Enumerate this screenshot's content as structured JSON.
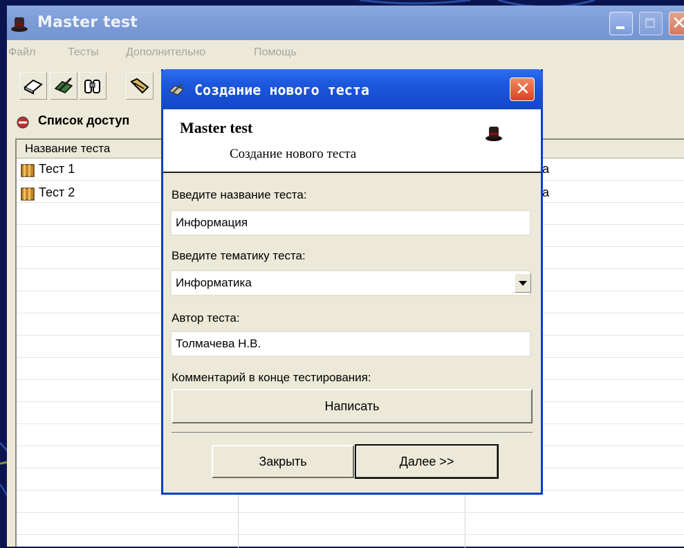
{
  "main_window": {
    "title": "Master test",
    "menu": [
      "Файл",
      "Тесты",
      "Дополнительно",
      "Помощь"
    ],
    "list_heading": "Список доступ",
    "list_columns": [
      "Название теста"
    ],
    "tests": [
      {
        "name": "Тест 1",
        "tail": "а"
      },
      {
        "name": "Тест 2",
        "tail": "а"
      }
    ]
  },
  "dialog": {
    "title": "Создание нового теста",
    "banner_title": "Master test",
    "banner_subtitle": "Создание нового теста",
    "name_label": "Введите название теста:",
    "name_value": "Информация",
    "topic_label": "Введите тематику теста:",
    "topic_value": "Информатика",
    "author_label": "Автор теста:",
    "author_value": "Толмачева Н.В.",
    "comment_label": "Комментарий в конце тестирования:",
    "write_button": "Написать",
    "close_button": "Закрыть",
    "next_button": "Далее >>"
  },
  "colors": {
    "dialog_title_bar": "#1c58dd",
    "main_title_bar": "#7c9bd6",
    "window_face": "#ece9d8"
  }
}
